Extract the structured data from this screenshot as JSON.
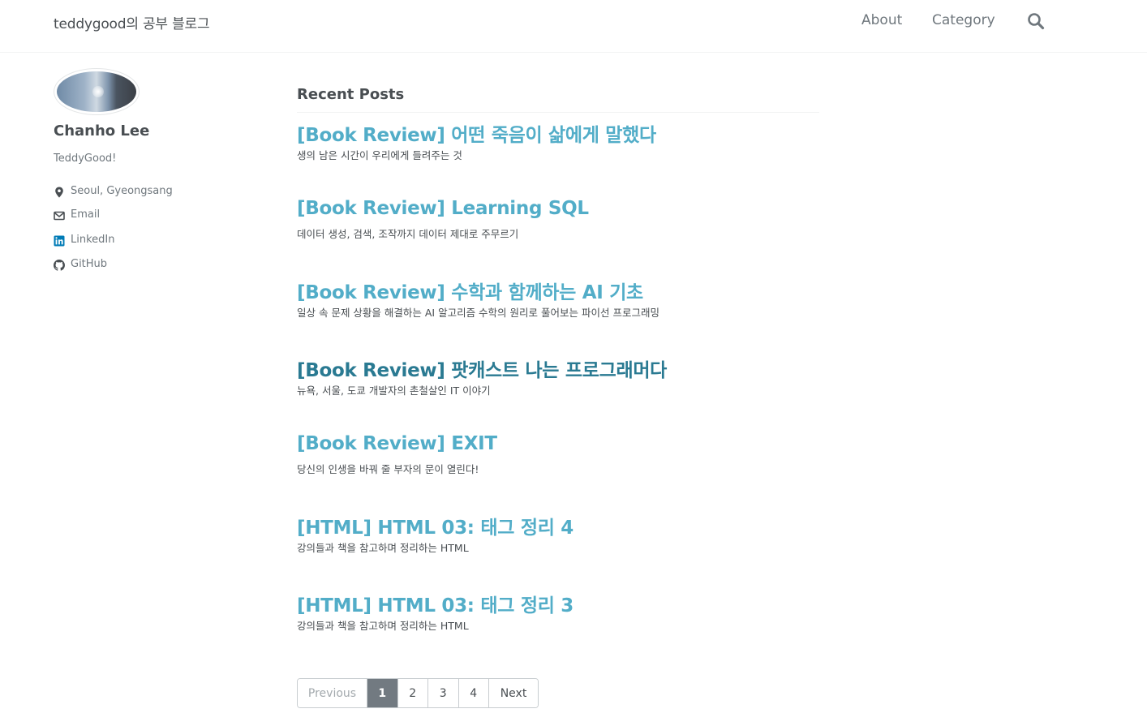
{
  "header": {
    "site_title": "teddygood의 공부 블로그",
    "nav": [
      {
        "label": "About"
      },
      {
        "label": "Category"
      }
    ],
    "search_icon": "search-icon"
  },
  "sidebar": {
    "avatar_icon": "avatar",
    "name": "Chanho Lee",
    "bio": "TeddyGood!",
    "links": [
      {
        "icon": "map-marker-icon",
        "label": "Seoul, Gyeongsang"
      },
      {
        "icon": "envelope-icon",
        "label": "Email"
      },
      {
        "icon": "linkedin-icon",
        "label": "LinkedIn"
      },
      {
        "icon": "github-icon",
        "label": "GitHub"
      }
    ]
  },
  "main": {
    "page_title": "Recent Posts",
    "posts": [
      {
        "title": "[Book Review] 어떤 죽음이 삶에게 말했다",
        "excerpt": "생의 남은 시간이 우리에게 들려주는 것"
      },
      {
        "title": "[Book Review] Learning SQL",
        "excerpt": "데이터 생성, 검색, 조작까지 데이터 제대로 주무르기"
      },
      {
        "title": "[Book Review] 수학과 함께하는 AI 기초",
        "excerpt": "일상 속 문제 상황을 해결하는 AI 알고리즘 수학의 원리로 풀어보는 파이선 프로그래밍"
      },
      {
        "title": "[Book Review] 팟캐스트 나는 프로그래머다",
        "excerpt": "뉴욕, 서울, 도쿄 개발자의 촌철살인 IT 이야기"
      },
      {
        "title": "[Book Review] EXIT",
        "excerpt": "당신의 인생을 바꿔 줄 부자의 문이 열린다!"
      },
      {
        "title": "[HTML] HTML 03: 태그 정리 4",
        "excerpt": "강의들과 책을 참고하며 정리하는 HTML"
      },
      {
        "title": "[HTML] HTML 03: 태그 정리 3",
        "excerpt": "강의들과 책을 참고하며 정리하는 HTML"
      }
    ]
  },
  "pagination": {
    "previous": "Previous",
    "pages": [
      "1",
      "2",
      "3",
      "4"
    ],
    "current": "1",
    "next": "Next"
  },
  "colors": {
    "link": "#52adc8",
    "link_hover": "#2a7a92",
    "text": "#494e52",
    "muted": "#6f777d",
    "pagination_current": "#727a81"
  }
}
